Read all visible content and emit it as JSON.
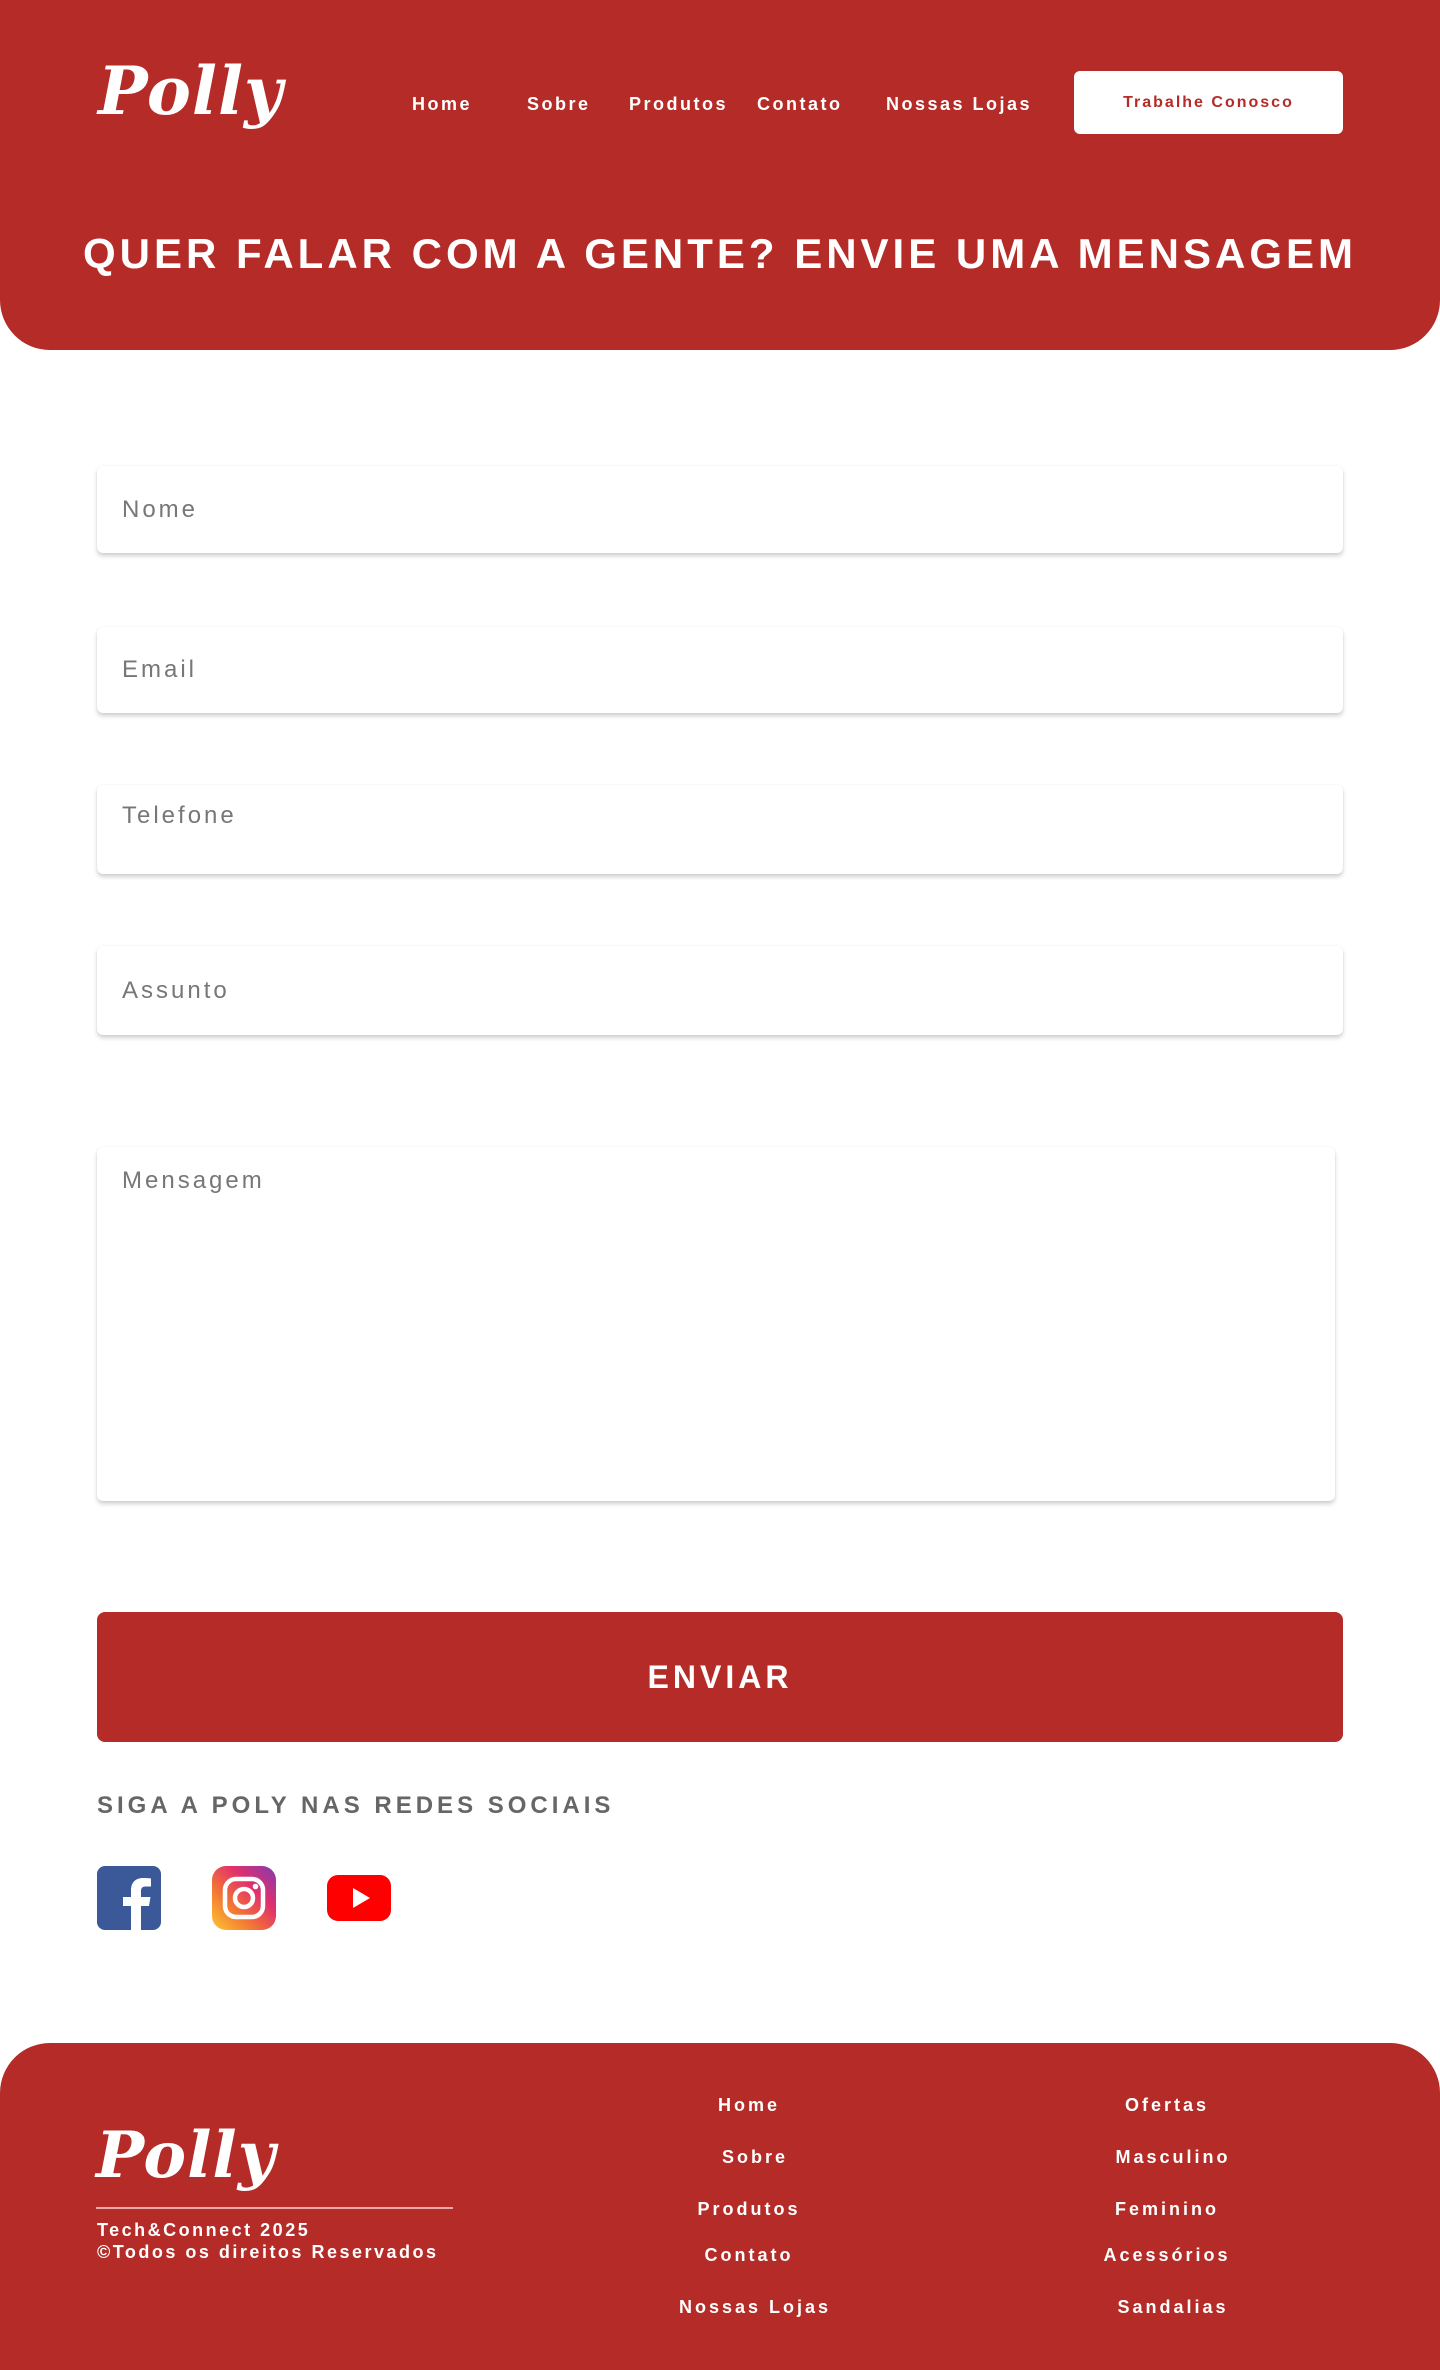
{
  "header": {
    "logo": "Polly",
    "nav": [
      "Home",
      "Sobre",
      "Produtos",
      "Contato",
      "Nossas Lojas"
    ],
    "cta_label": "Trabalhe Conosco",
    "title": "QUER FALAR COM A GENTE? ENVIE UMA MENSAGEM",
    "bg_color": "#b42b27"
  },
  "form": {
    "name_placeholder": "Nome",
    "email_placeholder": "Email",
    "phone_placeholder": "Telefone",
    "subject_placeholder": "Assunto",
    "message_placeholder": "Mensagem",
    "submit_label": "ENVIAR"
  },
  "social": {
    "title": "SIGA A POLY NAS REDES SOCIAIS",
    "icons": [
      "facebook-icon",
      "instagram-icon",
      "youtube-icon"
    ]
  },
  "footer": {
    "logo": "Polly",
    "line1": "Tech&Connect 2025",
    "line2": "©Todos os direitos Reservados",
    "col1": [
      "Home",
      "Sobre",
      "Produtos",
      "Contato",
      "Nossas Lojas"
    ],
    "col2": [
      "Ofertas",
      "Masculino",
      "Feminino",
      "Acessórios",
      "Sandalias"
    ]
  }
}
